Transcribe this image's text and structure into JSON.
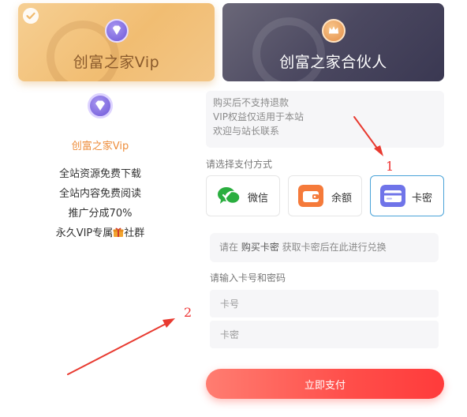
{
  "plans": [
    {
      "name": "创富之家Vip",
      "selected": true
    },
    {
      "name": "创富之家合伙人",
      "selected": false
    }
  ],
  "vip_info": {
    "name": "创富之家Vip",
    "benefits": [
      "全站资源免费下载",
      "全站内容免费阅读",
      "推广分成70%",
      "永久VIP专属",
      "社群"
    ]
  },
  "notice": {
    "lines": [
      "购买后不支持退款",
      "VIP权益仅适用于本站",
      "欢迎与站长联系"
    ]
  },
  "payment": {
    "label": "请选择支付方式",
    "options": [
      {
        "label": "微信",
        "icon": "wechat-icon",
        "color": "#2aae3f"
      },
      {
        "label": "余额",
        "icon": "wallet-icon",
        "color": "#f57a3a"
      },
      {
        "label": "卡密",
        "icon": "card-icon",
        "color": "#6f74e9",
        "selected": true
      }
    ]
  },
  "exchange": {
    "prefix": "请在 ",
    "link": "购买卡密",
    "suffix": " 获取卡密后在此进行兑换"
  },
  "card_form": {
    "label": "请输入卡号和密码",
    "number_placeholder": "卡号",
    "password_placeholder": "卡密"
  },
  "submit_label": "立即支付",
  "annotations": [
    "1",
    "2"
  ],
  "colors": {
    "accent": "#ff4e4a",
    "vip_orange": "#ee8e3c",
    "selected_border": "#4aa3d8"
  }
}
